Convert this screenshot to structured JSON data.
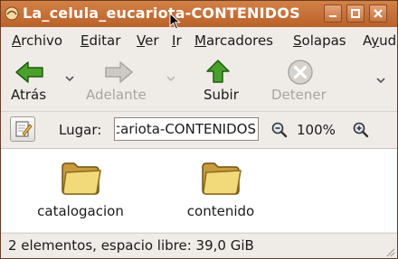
{
  "window": {
    "title": "La_celula_eucariota-CONTENIDOS",
    "accent": "#c06a33"
  },
  "menubar": {
    "items": [
      "Archivo",
      "Editar",
      "Ver",
      "Ir",
      "Marcadores",
      "Solapas",
      "Ayuda"
    ],
    "underline": [
      "A",
      "E",
      "V",
      "I",
      "M",
      "S",
      "y"
    ]
  },
  "toolbar": {
    "back_label": "Atrás",
    "forward_label": "Adelante",
    "up_label": "Subir",
    "stop_label": "Detener"
  },
  "location": {
    "label": "Lugar:",
    "value": "La_celula_eucariota-CONTENIDOS",
    "zoom": "100%"
  },
  "files": [
    {
      "name": "catalogacion"
    },
    {
      "name": "contenido"
    }
  ],
  "status": {
    "text": "2 elementos, espacio libre: 39,0 GiB"
  }
}
